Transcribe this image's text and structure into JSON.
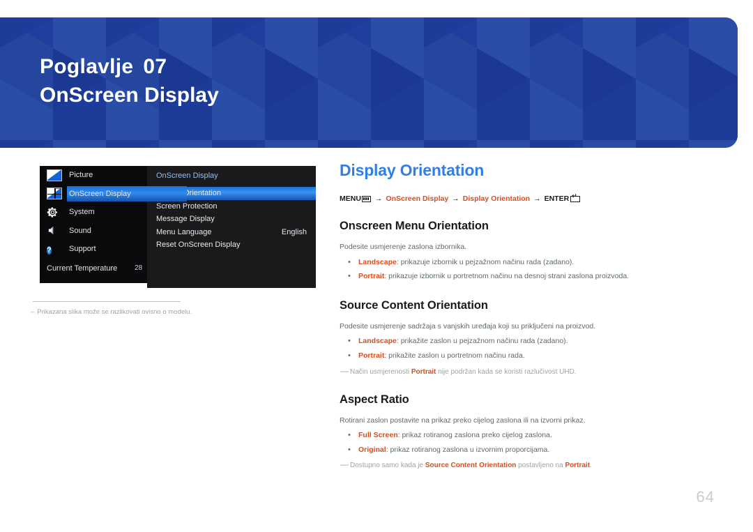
{
  "banner": {
    "chapter_label": "Poglavlje",
    "chapter_number": "07",
    "chapter_title": "OnScreen Display",
    "bg_color": "#1f3f9e"
  },
  "osd": {
    "left_menu": [
      {
        "label": "Picture",
        "icon": "picture-icon",
        "selected": false
      },
      {
        "label": "OnScreen Display",
        "icon": "onscreen-display-icon",
        "selected": true
      },
      {
        "label": "System",
        "icon": "gear-icon",
        "selected": false
      },
      {
        "label": "Sound",
        "icon": "speaker-icon",
        "selected": false
      },
      {
        "label": "Support",
        "icon": "question-circle-icon",
        "selected": false
      }
    ],
    "temperature_label": "Current Temperature",
    "temperature_value": "28",
    "submenu_title": "OnScreen Display",
    "submenu_items": [
      {
        "label": "Display Orientation",
        "value": "",
        "selected": true
      },
      {
        "label": "Screen Protection",
        "value": "",
        "selected": false
      },
      {
        "label": "Message Display",
        "value": "",
        "selected": false
      },
      {
        "label": "Menu Language",
        "value": "English",
        "selected": false
      },
      {
        "label": "Reset OnScreen Display",
        "value": "",
        "selected": false
      }
    ],
    "highlight_color": "#2f8bf0"
  },
  "osd_footnote": {
    "dash": "–",
    "text": "Prikazana slika može se razlikovati ovisno o modelu."
  },
  "content": {
    "page_title": "Display Orientation",
    "breadcrumb": {
      "menu_label": "MENU",
      "arrow": "→",
      "link1": "OnScreen Display",
      "link2": "Display Orientation",
      "enter_label": "ENTER"
    },
    "sections": [
      {
        "heading": "Onscreen Menu Orientation",
        "intro": "Podesite usmjerenje zaslona izbornika.",
        "bullets": [
          {
            "term": "Landscape",
            "rest": ": prikazuje izbornik u pejzažnom načinu rada (zadano)."
          },
          {
            "term": "Portrait",
            "rest": ": prikazuje izbornik u portretnom načinu na desnoj strani zaslona proizvoda."
          }
        ],
        "note": null
      },
      {
        "heading": "Source Content Orientation",
        "intro": "Podesite usmjerenje sadržaja s vanjskih uređaja koji su priključeni na proizvod.",
        "bullets": [
          {
            "term": "Landscape",
            "rest": ": prikažite zaslon u pejzažnom načinu rada (zadano)."
          },
          {
            "term": "Portrait",
            "rest": ": prikažite zaslon u portretnom načinu rada."
          }
        ],
        "note": {
          "pre": "Način usmjerenosti ",
          "term": "Portrait",
          "post": " nije podržan kada se koristi razlučivost UHD."
        }
      },
      {
        "heading": "Aspect Ratio",
        "intro": "Rotirani zaslon postavite na prikaz preko cijelog zaslona ili na izvorni prikaz.",
        "bullets": [
          {
            "term": "Full Screen",
            "rest": ": prikaz rotiranog zaslona preko cijelog zaslona."
          },
          {
            "term": "Original",
            "rest": ": prikaz rotiranog zaslona u izvornim proporcijama."
          }
        ],
        "note": {
          "pre": "Dostupno samo kada je ",
          "term": "Source Content Orientation",
          "post": " postavljeno na ",
          "term2": "Portrait",
          "post2": "."
        }
      }
    ],
    "accent_color": "#2f7fe8",
    "term_color": "#e04a18"
  },
  "page_number": "64"
}
